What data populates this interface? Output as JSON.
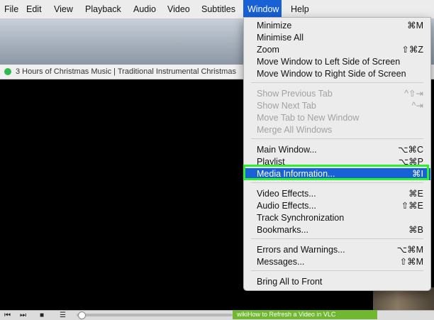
{
  "menubar": {
    "items": [
      {
        "label": "File"
      },
      {
        "label": "Edit"
      },
      {
        "label": "View"
      },
      {
        "label": "Playback"
      },
      {
        "label": "Audio"
      },
      {
        "label": "Video"
      },
      {
        "label": "Subtitles"
      },
      {
        "label": "Window"
      },
      {
        "label": "Help"
      }
    ],
    "active_label": "Window"
  },
  "player": {
    "window_title": "3 Hours of Christmas Music | Traditional Instrumental Christmas",
    "status_dot_color": "#30b94e",
    "controls": {
      "rewind_icon": "⏮",
      "forward_icon": "⏭",
      "stop_icon": "■",
      "playlist_icon": "☰"
    },
    "banner_text": "wikiHow to Refresh a Video in VLC"
  },
  "window_menu": {
    "items": [
      {
        "label": "Minimize",
        "shortcut": "⌘M"
      },
      {
        "label": "Minimise All",
        "shortcut": ""
      },
      {
        "label": "Zoom",
        "shortcut": "⇧⌘Z"
      },
      {
        "label": "Move Window to Left Side of Screen",
        "shortcut": ""
      },
      {
        "label": "Move Window to Right Side of Screen",
        "shortcut": ""
      },
      {
        "label": "Show Previous Tab",
        "shortcut": "^⇧⇥"
      },
      {
        "label": "Show Next Tab",
        "shortcut": "^⇥"
      },
      {
        "label": "Move Tab to New Window",
        "shortcut": ""
      },
      {
        "label": "Merge All Windows",
        "shortcut": ""
      },
      {
        "label": "Main Window...",
        "shortcut": "⌥⌘C"
      },
      {
        "label": "Playlist",
        "shortcut": "⌥⌘P"
      },
      {
        "label": "Media Information...",
        "shortcut": "⌘I"
      },
      {
        "label": "Video Effects...",
        "shortcut": "⌘E"
      },
      {
        "label": "Audio Effects...",
        "shortcut": "⇧⌘E"
      },
      {
        "label": "Track Synchronization",
        "shortcut": ""
      },
      {
        "label": "Bookmarks...",
        "shortcut": "⌘B"
      },
      {
        "label": "Errors and Warnings...",
        "shortcut": "⌥⌘M"
      },
      {
        "label": "Messages...",
        "shortcut": "⇧⌘M"
      },
      {
        "label": "Bring All to Front",
        "shortcut": ""
      }
    ],
    "highlighted_item": "Media Information...",
    "disabled_items": [
      "Show Previous Tab",
      "Show Next Tab",
      "Move Tab to New Window",
      "Merge All Windows"
    ]
  },
  "colors": {
    "menu_highlight": "#1662d6",
    "callout_border": "#2df12d",
    "menubar_active": "#1860d6"
  }
}
